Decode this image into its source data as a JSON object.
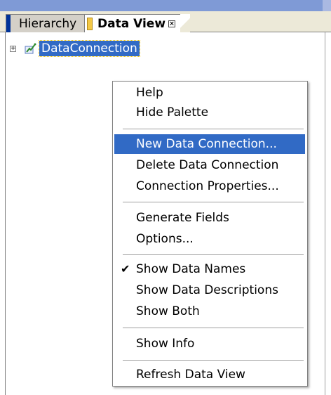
{
  "tabs": [
    {
      "label": "Hierarchy",
      "active": false
    },
    {
      "label": "Data View",
      "active": true
    }
  ],
  "tree": {
    "expander_symbol": "+",
    "node_icon": "data-connection-icon",
    "node_label": "DataConnection"
  },
  "context_menu": {
    "highlight_color": "#316ac5",
    "items": [
      {
        "label": "Help"
      },
      {
        "label": "Hide Palette"
      },
      {
        "label": "New Data Connection...",
        "highlighted": true
      },
      {
        "label": "Delete Data Connection"
      },
      {
        "label": "Connection Properties..."
      },
      {
        "label": "Generate Fields"
      },
      {
        "label": "Options..."
      },
      {
        "label": "Show Data Names",
        "checked": true
      },
      {
        "label": "Show Data Descriptions"
      },
      {
        "label": "Show Both"
      },
      {
        "label": "Show Info"
      },
      {
        "label": "Refresh Data View"
      }
    ]
  }
}
